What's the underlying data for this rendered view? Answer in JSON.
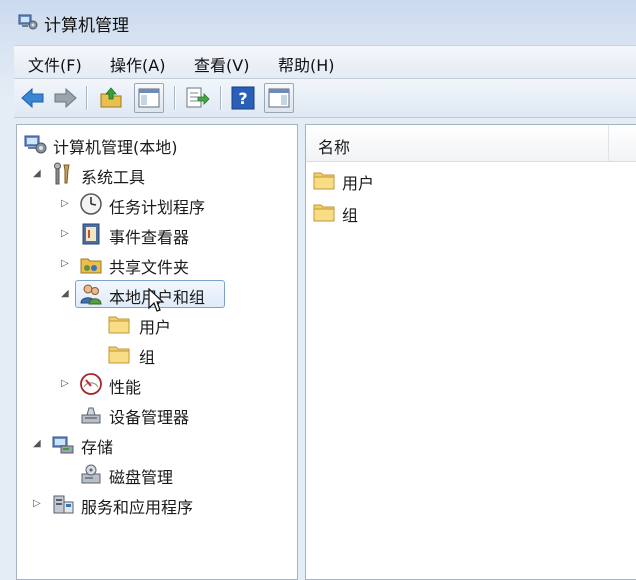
{
  "window": {
    "title": "计算机管理"
  },
  "menu": [
    "文件(F)",
    "操作(A)",
    "查看(V)",
    "帮助(H)"
  ],
  "tree": {
    "root": "计算机管理(本地)",
    "system_tools": "系统工具",
    "task_scheduler": "任务计划程序",
    "event_viewer": "事件查看器",
    "shared_folders": "共享文件夹",
    "local_users_groups": "本地用户和组",
    "users": "用户",
    "groups": "组",
    "performance": "性能",
    "device_manager": "设备管理器",
    "storage": "存储",
    "disk_management": "磁盘管理",
    "services_apps": "服务和应用程序"
  },
  "list": {
    "column_name": "名称",
    "items": [
      "用户",
      "组"
    ]
  },
  "colors": {
    "folder": "#f3cf6a",
    "selection_border": "#7da2ce",
    "help_blue": "#2a5fb8"
  }
}
